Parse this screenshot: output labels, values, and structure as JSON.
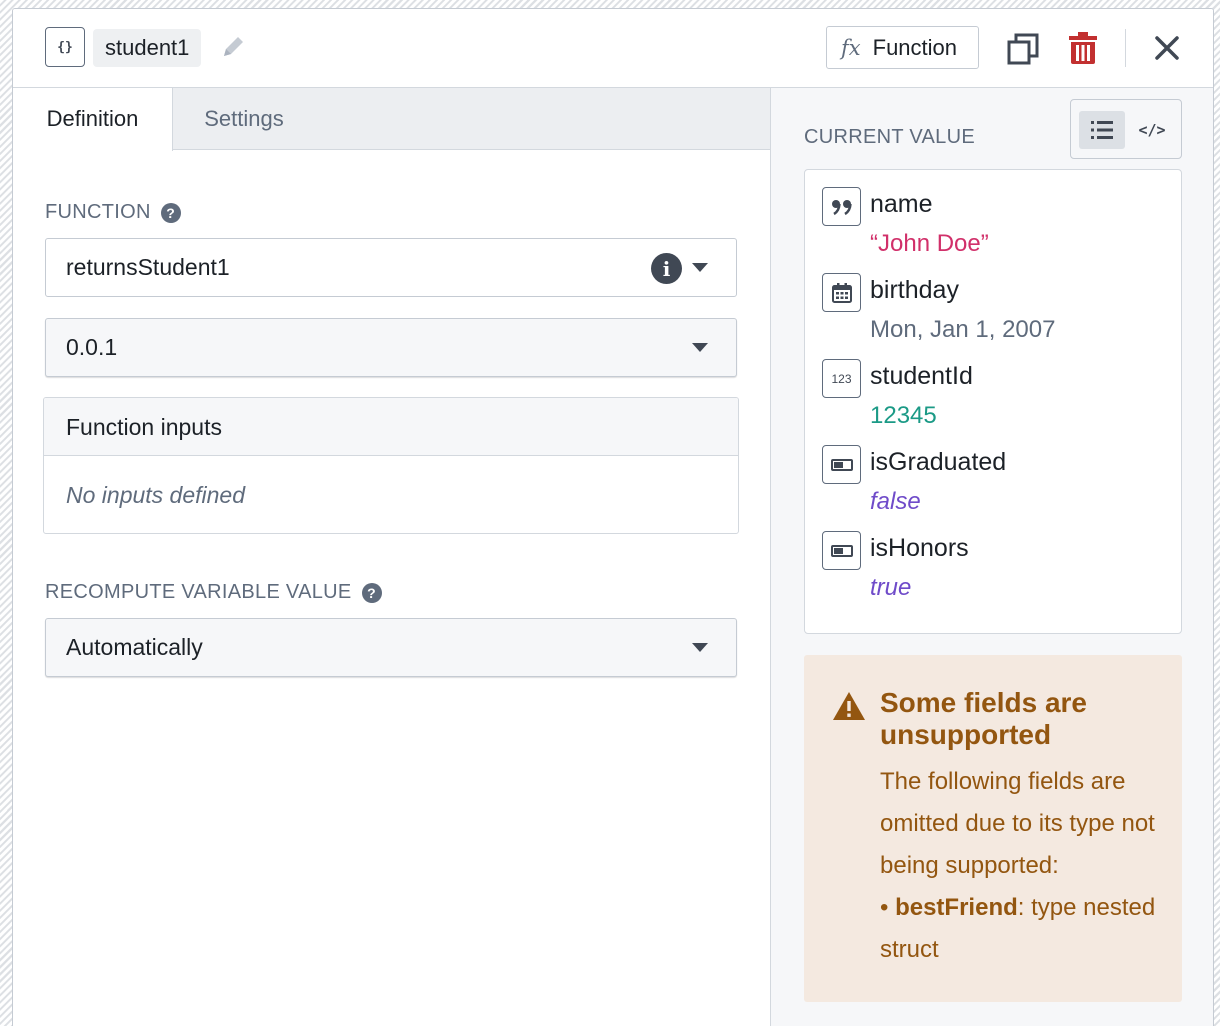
{
  "header": {
    "variable_icon": "{}",
    "variable_name": "student1",
    "function_button_icon": "fx",
    "function_button_label": "Function",
    "icons": [
      "braces-icon",
      "pencil-icon",
      "copy-icon",
      "trash-icon",
      "close-icon"
    ]
  },
  "tabs": [
    {
      "label": "Definition",
      "active": true
    },
    {
      "label": "Settings",
      "active": false
    }
  ],
  "function_section": {
    "label": "FUNCTION",
    "help": "?",
    "selected_function": "returnsStudent1",
    "info_glyph": "i",
    "selected_version": "0.0.1"
  },
  "function_inputs": {
    "title": "Function inputs",
    "empty_text": "No inputs defined"
  },
  "recompute": {
    "label": "RECOMPUTE VARIABLE VALUE",
    "help": "?",
    "selected": "Automatically"
  },
  "current_value": {
    "label": "CURRENT VALUE",
    "code_toggle": "</>",
    "fields": [
      {
        "name": "name",
        "value": "“John Doe”",
        "icon": "quote-icon",
        "icon_glyph": "99",
        "color": "#d1306a"
      },
      {
        "name": "birthday",
        "value": "Mon, Jan 1, 2007",
        "icon": "calendar-icon",
        "icon_glyph": "",
        "color": "#5f6b7c"
      },
      {
        "name": "studentId",
        "value": "12345",
        "icon": "numeric-icon",
        "icon_glyph": "123",
        "color": "#1b9a86"
      },
      {
        "name": "isGraduated",
        "value": "false",
        "icon": "boolean-icon",
        "icon_glyph": "",
        "color": "#6f4bc9"
      },
      {
        "name": "isHonors",
        "value": "true",
        "icon": "boolean-icon",
        "icon_glyph": "",
        "color": "#6f4bc9"
      }
    ]
  },
  "warning": {
    "title": "Some fields are unsupported",
    "body": "The following fields are omitted due to its type not being supported:",
    "bullet_field": "bestFriend",
    "bullet_rest": ": type nested struct",
    "color": "#935610",
    "background": "#f4e9e0"
  }
}
